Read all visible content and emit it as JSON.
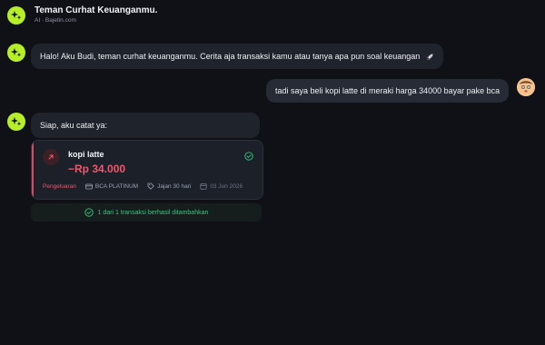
{
  "header": {
    "title": "Teman Curhat Keuanganmu.",
    "subtitle": "AI · Bajetin.com"
  },
  "messages": {
    "bot_greeting": "Halo! Aku Budi, teman curhat keuanganmu. Cerita aja transaksi kamu atau tanya apa pun soal keuangan",
    "user_message": "tadi saya beli kopi latte di meraki harga 34000 bayar pake bca",
    "bot_reply": "Siap, aku catat ya:"
  },
  "transaction": {
    "name": "kopi latte",
    "amount": "−Rp 34.000",
    "category": "Pengeluaran",
    "account": "BCA PLATINUM",
    "tag": "Jajan 30 hari",
    "date": "03 Jun 2026"
  },
  "status": {
    "success_text": "1 dari 1 transaksi berhasil ditambahkan"
  },
  "colors": {
    "background": "#0f1117",
    "bot_avatar": "#b6ef2a",
    "expense": "#f0566c",
    "success": "#38c77e"
  },
  "icons": {
    "bot": "sparkle-icon",
    "greeting_emoji": "rocket-icon",
    "expense": "arrow-up-right-icon",
    "done": "check-circle-icon",
    "account": "card-icon",
    "tag": "tag-icon",
    "date": "calendar-icon"
  }
}
